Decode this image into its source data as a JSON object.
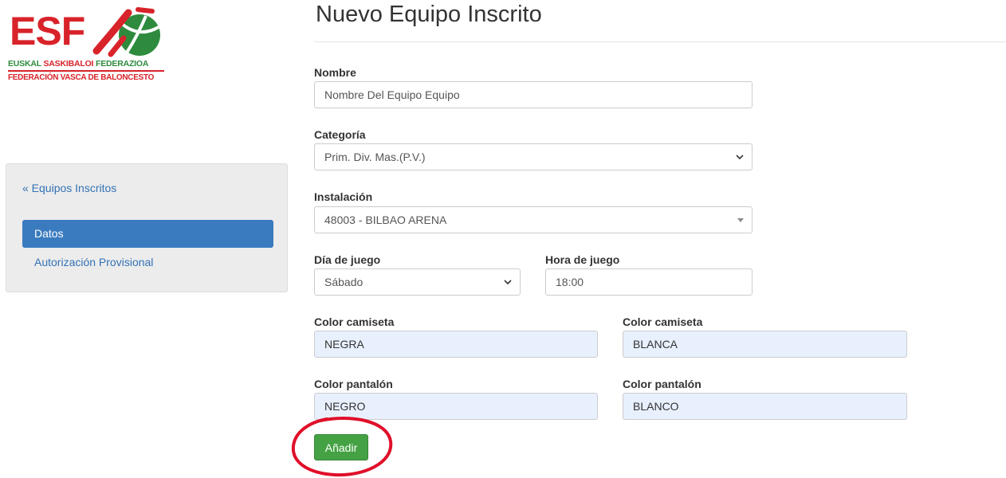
{
  "logo": {
    "acronym": "ESF",
    "line1_part1": "EUSKAL",
    "line1_part2": "SASKIBALOI",
    "line1_part3": "FEDERAZIOA",
    "line2": "FEDERACIÓN VASCA DE BALONCESTO",
    "colors": {
      "red": "#d8232a",
      "green": "#2e8b3e"
    }
  },
  "sidebar": {
    "back_link": "« Equipos Inscritos",
    "items": [
      {
        "label": "Datos",
        "active": true
      },
      {
        "label": "Autorización Provisional",
        "active": false
      }
    ]
  },
  "main": {
    "title": "Nuevo Equipo Inscrito",
    "fields": {
      "nombre": {
        "label": "Nombre",
        "value": "Nombre Del Equipo Equipo"
      },
      "categoria": {
        "label": "Categoría",
        "value": "Prim. Div. Mas.(P.V.)"
      },
      "instalacion": {
        "label": "Instalación",
        "value": "48003 - BILBAO ARENA"
      },
      "dia": {
        "label": "Día de juego",
        "value": "Sábado"
      },
      "hora": {
        "label": "Hora de juego",
        "value": "18:00"
      },
      "camiseta1": {
        "label": "Color camiseta",
        "value": "NEGRA"
      },
      "camiseta2": {
        "label": "Color camiseta",
        "value": "BLANCA"
      },
      "pantalon1": {
        "label": "Color pantalón",
        "value": "NEGRO"
      },
      "pantalon2": {
        "label": "Color pantalón",
        "value": "BLANCO"
      }
    },
    "add_button": "Añadir",
    "colors": {
      "primary": "#3a7bbf",
      "success": "#44a244",
      "autofill": "#e8f0fe",
      "annotation": "#e0102a"
    }
  }
}
